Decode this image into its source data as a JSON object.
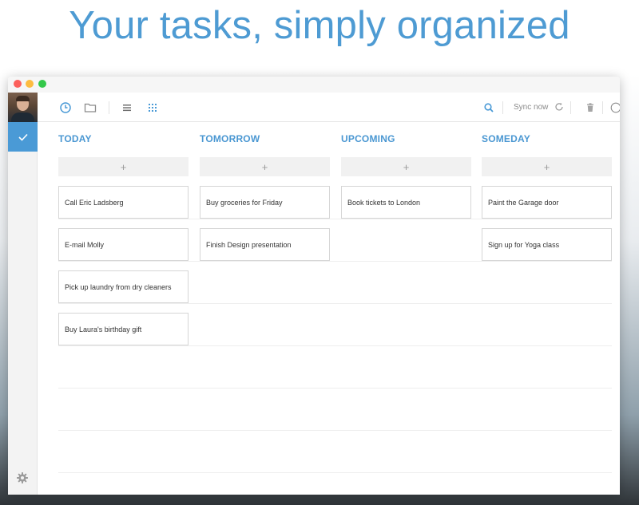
{
  "headline": "Your tasks, simply organized",
  "toolbar": {
    "sync_label": "Sync now"
  },
  "icons": {
    "clock": "clock-icon",
    "folder": "folder-icon",
    "list": "list-view-icon",
    "grid": "grid-view-icon",
    "search": "search-icon",
    "sync": "sync-icon",
    "trash": "trash-icon",
    "circle": "circle-icon",
    "check": "check-icon",
    "gear": "gear-icon"
  },
  "colors": {
    "accent": "#4a9ad6",
    "headline": "#4e9bd3"
  },
  "columns": [
    {
      "title": "TODAY",
      "add_label": "+",
      "tasks": [
        "Call Eric Ladsberg",
        "E-mail Molly",
        "Pick up laundry from dry cleaners",
        "Buy Laura's birthday gift"
      ]
    },
    {
      "title": "TOMORROW",
      "add_label": "+",
      "tasks": [
        "Buy groceries for Friday",
        "Finish Design presentation"
      ]
    },
    {
      "title": "UPCOMING",
      "add_label": "+",
      "tasks": [
        "Book tickets to London"
      ]
    },
    {
      "title": "SOMEDAY",
      "add_label": "+",
      "tasks": [
        "Paint the Garage door",
        "Sign up for Yoga class"
      ]
    }
  ]
}
